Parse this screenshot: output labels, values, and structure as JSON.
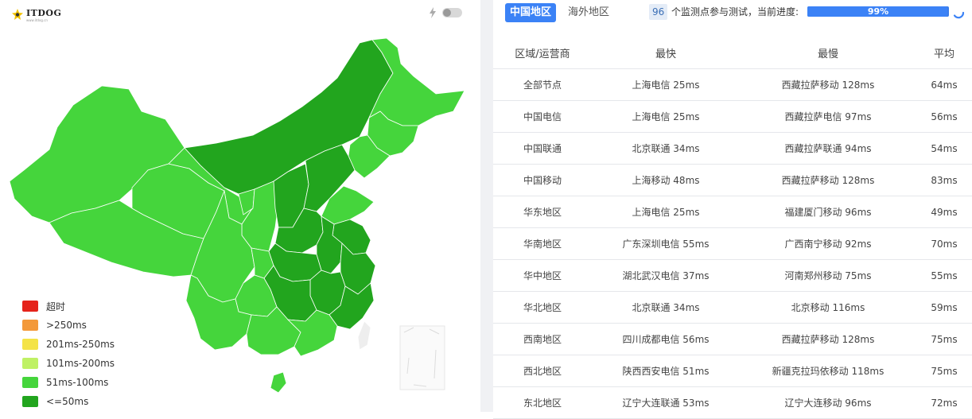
{
  "brand": {
    "name": "ITDOG",
    "sub": "www.itdog.cn"
  },
  "legend": [
    {
      "label": "超时",
      "color": "#e5231b"
    },
    {
      "label": ">250ms",
      "color": "#f3993a"
    },
    {
      "label": "201ms-250ms",
      "color": "#f4e347"
    },
    {
      "label": "101ms-200ms",
      "color": "#bff165"
    },
    {
      "label": "51ms-100ms",
      "color": "#45d53c"
    },
    {
      "label": "<=50ms",
      "color": "#22a51e"
    }
  ],
  "tabs": {
    "active": "中国地区",
    "inactive": "海外地区"
  },
  "status": {
    "count": "96",
    "text": "个监测点参与测试，当前进度:",
    "progress_label": "99%",
    "progress": 0.99
  },
  "table": {
    "headers": [
      "区域/运营商",
      "最快",
      "最慢",
      "平均"
    ],
    "rows": [
      [
        "全部节点",
        "上海电信 25ms",
        "西藏拉萨移动 128ms",
        "64ms"
      ],
      [
        "中国电信",
        "上海电信 25ms",
        "西藏拉萨电信 97ms",
        "56ms"
      ],
      [
        "中国联通",
        "北京联通 34ms",
        "西藏拉萨联通 94ms",
        "54ms"
      ],
      [
        "中国移动",
        "上海移动 48ms",
        "西藏拉萨移动 128ms",
        "83ms"
      ],
      [
        "华东地区",
        "上海电信 25ms",
        "福建厦门移动 96ms",
        "49ms"
      ],
      [
        "华南地区",
        "广东深圳电信 55ms",
        "广西南宁移动 92ms",
        "70ms"
      ],
      [
        "华中地区",
        "湖北武汉电信 37ms",
        "河南郑州移动 75ms",
        "55ms"
      ],
      [
        "华北地区",
        "北京联通 34ms",
        "北京移动 116ms",
        "59ms"
      ],
      [
        "西南地区",
        "四川成都电信 56ms",
        "西藏拉萨移动 128ms",
        "75ms"
      ],
      [
        "西北地区",
        "陕西西安电信 51ms",
        "新疆克拉玛依移动 118ms",
        "75ms"
      ],
      [
        "东北地区",
        "辽宁大连联通 53ms",
        "辽宁大连移动 96ms",
        "72ms"
      ]
    ]
  },
  "colors": {
    "map_light": "#45d53c",
    "map_dark": "#22a51e",
    "accent": "#3b82f6"
  }
}
